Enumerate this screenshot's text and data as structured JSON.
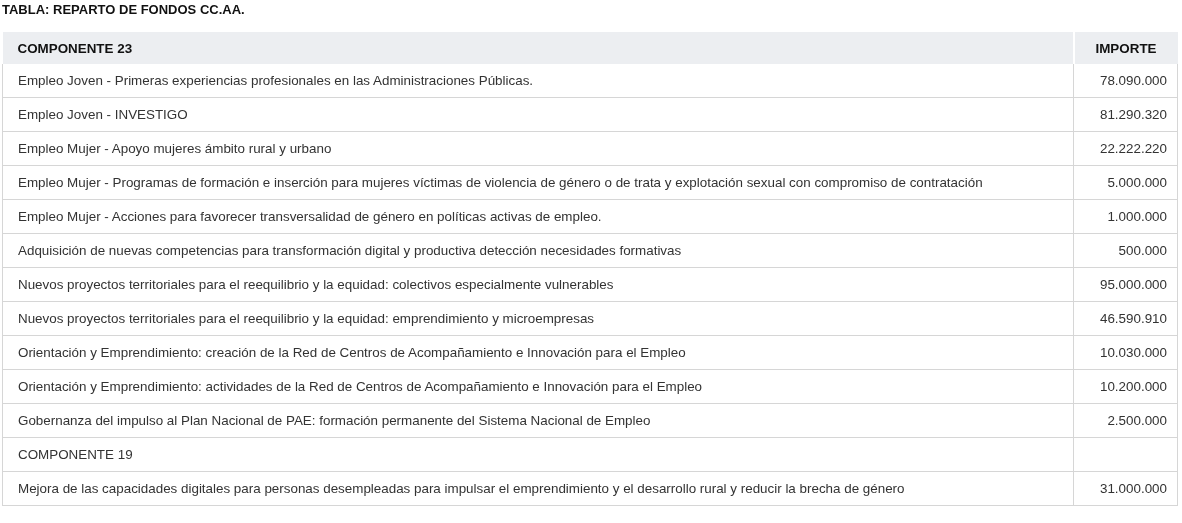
{
  "title": "TABLA: REPARTO DE FONDOS CC.AA.",
  "table": {
    "columns": [
      "COMPONENTE 23",
      "IMPORTE"
    ],
    "rows": [
      {
        "concept": "Empleo Joven - Primeras experiencias profesionales en las Administraciones Públicas.",
        "amount": "78.090.000"
      },
      {
        "concept": "Empleo Joven - INVESTIGO",
        "amount": "81.290.320"
      },
      {
        "concept": "Empleo Mujer - Apoyo mujeres ámbito rural y urbano",
        "amount": "22.222.220"
      },
      {
        "concept": "Empleo Mujer - Programas de formación e inserción para mujeres víctimas de violencia de género o de trata y explotación sexual con compromiso de contratación",
        "amount": "5.000.000"
      },
      {
        "concept": "Empleo Mujer - Acciones para favorecer transversalidad de género en políticas activas de empleo.",
        "amount": "1.000.000"
      },
      {
        "concept": "Adquisición de nuevas competencias para transformación digital y productiva detección necesidades formativas",
        "amount": "500.000"
      },
      {
        "concept": "Nuevos proyectos territoriales para el reequilibrio y la equidad: colectivos especialmente vulnerables",
        "amount": "95.000.000"
      },
      {
        "concept": "Nuevos proyectos territoriales para el reequilibrio y la equidad: emprendimiento y microempresas",
        "amount": "46.590.910"
      },
      {
        "concept": "Orientación y Emprendimiento: creación de la Red de Centros de Acompañamiento e Innovación para el Empleo",
        "amount": "10.030.000"
      },
      {
        "concept": "Orientación y Emprendimiento: actividades de la Red de Centros de Acompañamiento e Innovación para el Empleo",
        "amount": "10.200.000"
      },
      {
        "concept": "Gobernanza del impulso al Plan Nacional de PAE: formación permanente del Sistema Nacional de Empleo",
        "amount": "2.500.000"
      },
      {
        "concept": "COMPONENTE 19"
      },
      {
        "concept": "Mejora de las capacidades digitales para personas desempleadas para impulsar el emprendimiento y el desarrollo rural y reducir la brecha de género",
        "amount": "31.000.000"
      }
    ]
  }
}
